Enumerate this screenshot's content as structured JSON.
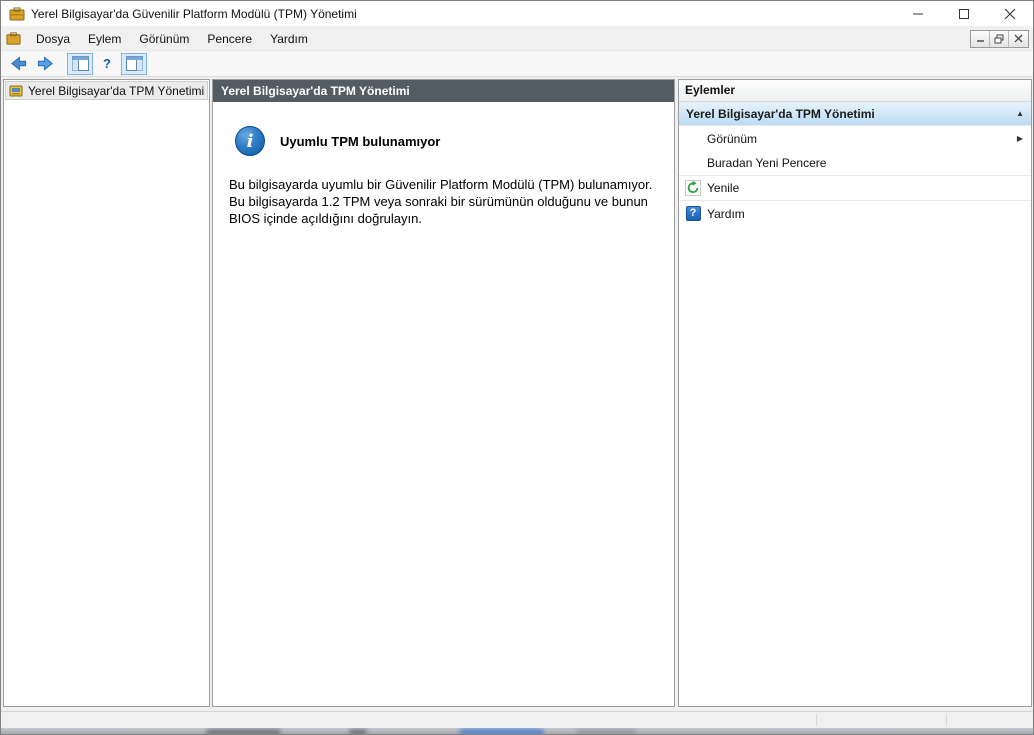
{
  "window": {
    "title": "Yerel Bilgisayar'da Güvenilir Platform Modülü (TPM) Yönetimi"
  },
  "menu": {
    "items": [
      "Dosya",
      "Eylem",
      "Görünüm",
      "Pencere",
      "Yardım"
    ]
  },
  "tree": {
    "selected_item": "Yerel Bilgisayar'da TPM Yönetimi"
  },
  "main": {
    "header": "Yerel Bilgisayar'da TPM Yönetimi",
    "message_title": "Uyumlu TPM bulunamıyor",
    "message_body": "Bu bilgisayarda uyumlu bir Güvenilir Platform Modülü (TPM) bulunamıyor.\nBu bilgisayarda 1.2 TPM veya sonraki bir sürümünün olduğunu ve bunun\nBIOS içinde açıldığını doğrulayın."
  },
  "actions": {
    "header": "Eylemler",
    "section_label": "Yerel Bilgisayar'da TPM Yönetimi",
    "items": [
      {
        "label": "Görünüm"
      },
      {
        "label": "Buradan Yeni Pencere"
      },
      {
        "label": "Yenile"
      },
      {
        "label": "Yardım"
      }
    ]
  },
  "icons": {
    "help_glyph": "?",
    "info_glyph": "i",
    "collapse_glyph": "▲",
    "submenu_glyph": "▶"
  },
  "colors": {
    "results_header_bg": "#535b63",
    "actions_section_bg": "#bcdcf3",
    "info_icon_blue": "#0b57a4",
    "refresh_green": "#2f9e3f"
  }
}
